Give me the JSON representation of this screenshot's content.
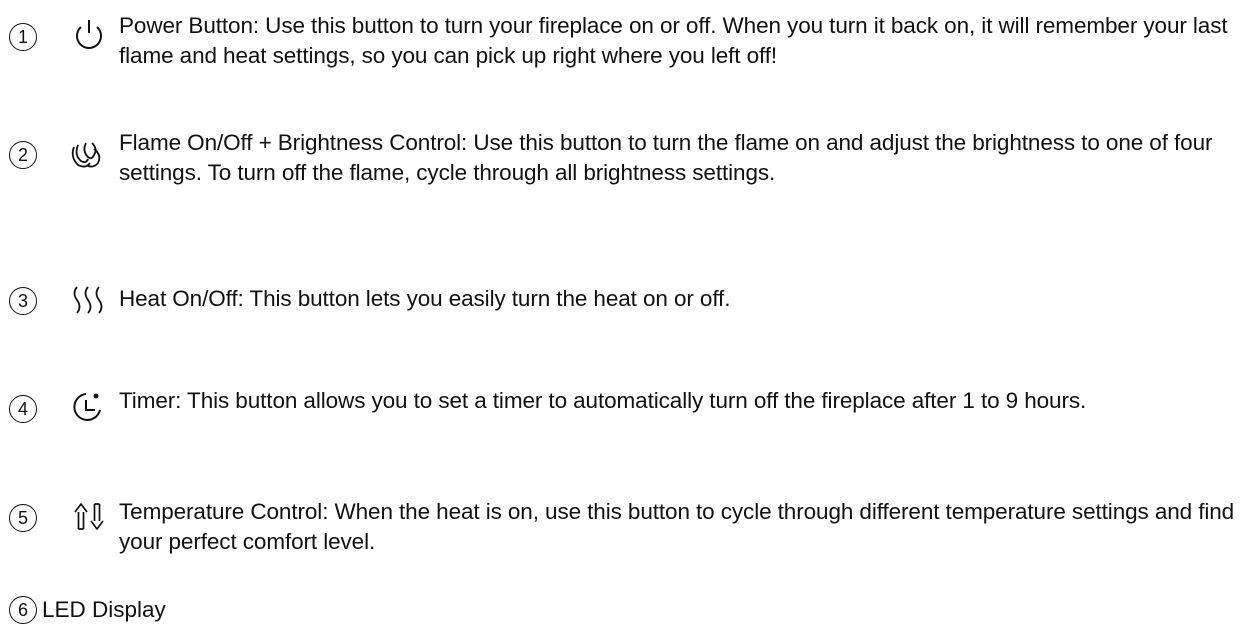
{
  "items": [
    {
      "number": "1",
      "icon": "power-icon",
      "text": "Power Button: Use this button to turn your fireplace on or off. When you turn it back on, it will remember your last flame and heat settings, so you can pick up right where you left off!"
    },
    {
      "number": "2",
      "icon": "flame-icon",
      "text": "Flame On/Off + Brightness Control: Use this button to turn the flame on and adjust the brightness to one of four settings. To turn off the flame, cycle through all brightness settings."
    },
    {
      "number": "3",
      "icon": "heat-icon",
      "text": "Heat On/Off: This button lets you easily turn the heat on or off."
    },
    {
      "number": "4",
      "icon": "timer-icon",
      "text": "Timer: This button allows you to set a timer to automatically turn off the fireplace after 1 to 9 hours."
    },
    {
      "number": "5",
      "icon": "temperature-arrows-icon",
      "text": "Temperature Control: When the heat is on, use this button to cycle through different temperature settings and find your perfect comfort level."
    },
    {
      "number": "6",
      "icon": "",
      "text": "LED Display"
    }
  ]
}
